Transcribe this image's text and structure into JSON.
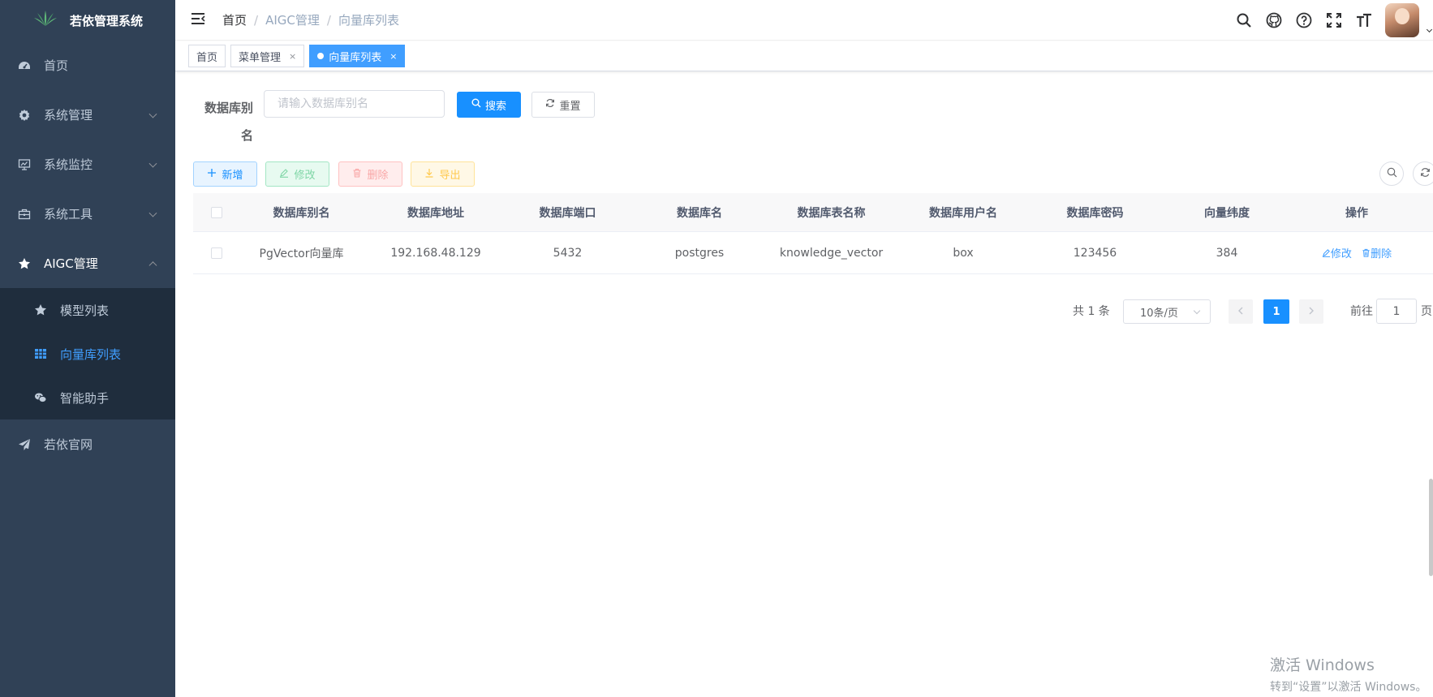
{
  "app": {
    "title": "若依管理系统",
    "accent": "#1890ff",
    "sidebar_bg": "#304156"
  },
  "sidebar": {
    "items": [
      {
        "label": "首页",
        "icon": "dashboard-icon"
      },
      {
        "label": "系统管理",
        "icon": "gear-icon"
      },
      {
        "label": "系统监控",
        "icon": "monitor-icon"
      },
      {
        "label": "系统工具",
        "icon": "toolbox-icon"
      },
      {
        "label": "AIGC管理",
        "icon": "star-icon"
      }
    ],
    "submenu": [
      {
        "label": "模型列表",
        "icon": "star-icon"
      },
      {
        "label": "向量库列表",
        "icon": "grid-icon"
      },
      {
        "label": "智能助手",
        "icon": "wechat-icon"
      }
    ],
    "footer_item": {
      "label": "若依官网",
      "icon": "paper-plane-icon"
    }
  },
  "breadcrumb": [
    "首页",
    "AIGC管理",
    "向量库列表"
  ],
  "tags": [
    {
      "label": "首页"
    },
    {
      "label": "菜单管理",
      "close": "×"
    },
    {
      "label": "向量库列表",
      "close": "×"
    }
  ],
  "search": {
    "label_line1": "数据库别",
    "label_line2": "名",
    "placeholder": "请输入数据库别名",
    "value": "",
    "search_btn": "搜索",
    "reset_btn": "重置"
  },
  "toolbar": {
    "add": "新增",
    "edit": "修改",
    "delete": "删除",
    "export": "导出"
  },
  "table": {
    "headers": [
      "数据库别名",
      "数据库地址",
      "数据库端口",
      "数据库名",
      "数据库表名称",
      "数据库用户名",
      "数据库密码",
      "向量纬度",
      "操作"
    ],
    "rows": [
      {
        "alias": "PgVector向量库",
        "host": "192.168.48.129",
        "port": "5432",
        "db": "postgres",
        "table": "knowledge_vector",
        "user": "box",
        "password": "123456",
        "dim": "384",
        "edit": "修改",
        "delete": "删除"
      }
    ]
  },
  "pagination": {
    "total": "共 1 条",
    "page_size": "10条/页",
    "current": "1",
    "goto_label": "前往",
    "goto_value": "1",
    "goto_suffix": "页"
  },
  "watermark": {
    "title": "激活 Windows",
    "subtitle": "转到“设置”以激活 Windows。"
  }
}
